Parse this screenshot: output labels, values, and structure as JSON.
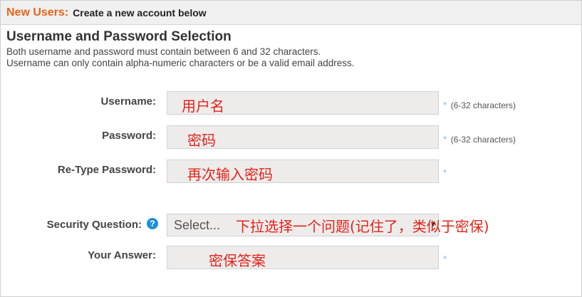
{
  "header": {
    "brand": "New Users:",
    "subtitle": "Create a new account below"
  },
  "section": {
    "title": "Username and Password Selection",
    "desc_line1": "Both username and password must contain between 6 and 32 characters.",
    "desc_line2": "Username can only contain alpha-numeric characters or be a valid email address."
  },
  "form": {
    "username": {
      "label": "Username:",
      "annotation": "用户名",
      "required": "*",
      "hint": "(6-32 characters)"
    },
    "password": {
      "label": "Password:",
      "annotation": "密码",
      "required": "*",
      "hint": "(6-32 characters)"
    },
    "retype": {
      "label": "Re-Type Password:",
      "annotation": "再次输入密码",
      "required": "*"
    },
    "security": {
      "label": "Security Question:",
      "help": "?",
      "selected": "Select...",
      "annotation": "下拉选择一个问题(记住了，类似于密保)"
    },
    "answer": {
      "label": "Your Answer:",
      "annotation": "密保答案",
      "required": "*"
    }
  },
  "colors": {
    "brand": "#e8641b",
    "annotation": "#e2231a",
    "required": "#7fb8e6",
    "help": "#1e8fd6"
  }
}
